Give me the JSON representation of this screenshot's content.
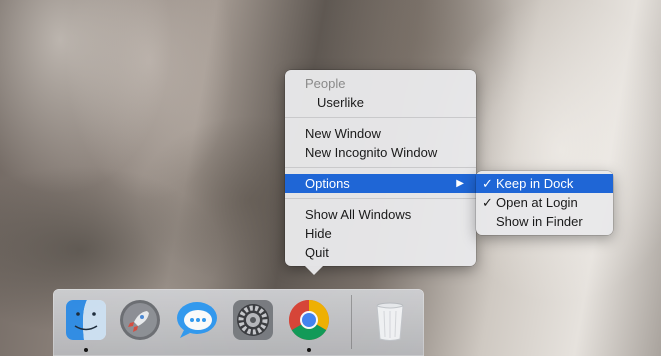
{
  "context_menu": {
    "section_header": "People",
    "profile": "Userlike",
    "new_window": "New Window",
    "new_incognito_window": "New Incognito Window",
    "options": "Options",
    "show_all_windows": "Show All Windows",
    "hide": "Hide",
    "quit": "Quit"
  },
  "options_submenu": {
    "keep_in_dock": "Keep in Dock",
    "open_at_login": "Open at Login",
    "show_in_finder": "Show in Finder",
    "keep_in_dock_checked": true,
    "open_at_login_checked": true,
    "checkmark": "✓",
    "arrow": "▶"
  },
  "dock": {
    "apps": [
      "finder",
      "launchpad",
      "messages",
      "system-preferences",
      "chrome",
      "trash"
    ],
    "running": [
      "finder",
      "chrome"
    ]
  },
  "colors": {
    "menu_highlight": "#1f66d6",
    "menu_background": "#e8e8ea"
  }
}
